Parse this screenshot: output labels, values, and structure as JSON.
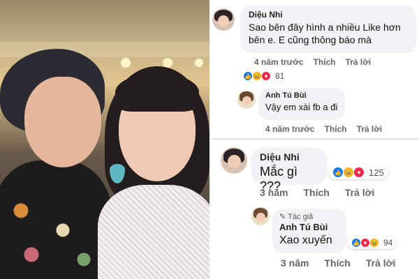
{
  "comment1": {
    "author": "Diệu Nhi",
    "text": "Sao bên đây hình a nhiều Like hơn bên e. E cũng thông báo mà",
    "time": "4 năm trước",
    "like_label": "Thích",
    "reply_label": "Trả lời",
    "reaction_count": "81"
  },
  "reply1": {
    "author": "Anh Tú Bùi",
    "text": "Vậy em xài fb a đi",
    "time": "4 năm trước",
    "like_label": "Thích",
    "reply_label": "Trả lời"
  },
  "comment2": {
    "author": "Diệu Nhi",
    "text": "Mắc gì ???",
    "time": "3 năm",
    "like_label": "Thích",
    "reply_label": "Trả lời",
    "reaction_count": "125"
  },
  "reply2": {
    "badge": "Tác giả",
    "author": "Anh Tú Bùi",
    "text": "Xao xuyến",
    "time": "3 năm",
    "like_label": "Thích",
    "reply_label": "Trả lời",
    "reaction_count": "94"
  },
  "colors": {
    "bubble": "#f0f2f5",
    "like": "#1877f2",
    "love": "#f0284a",
    "haha": "#f7b125"
  }
}
